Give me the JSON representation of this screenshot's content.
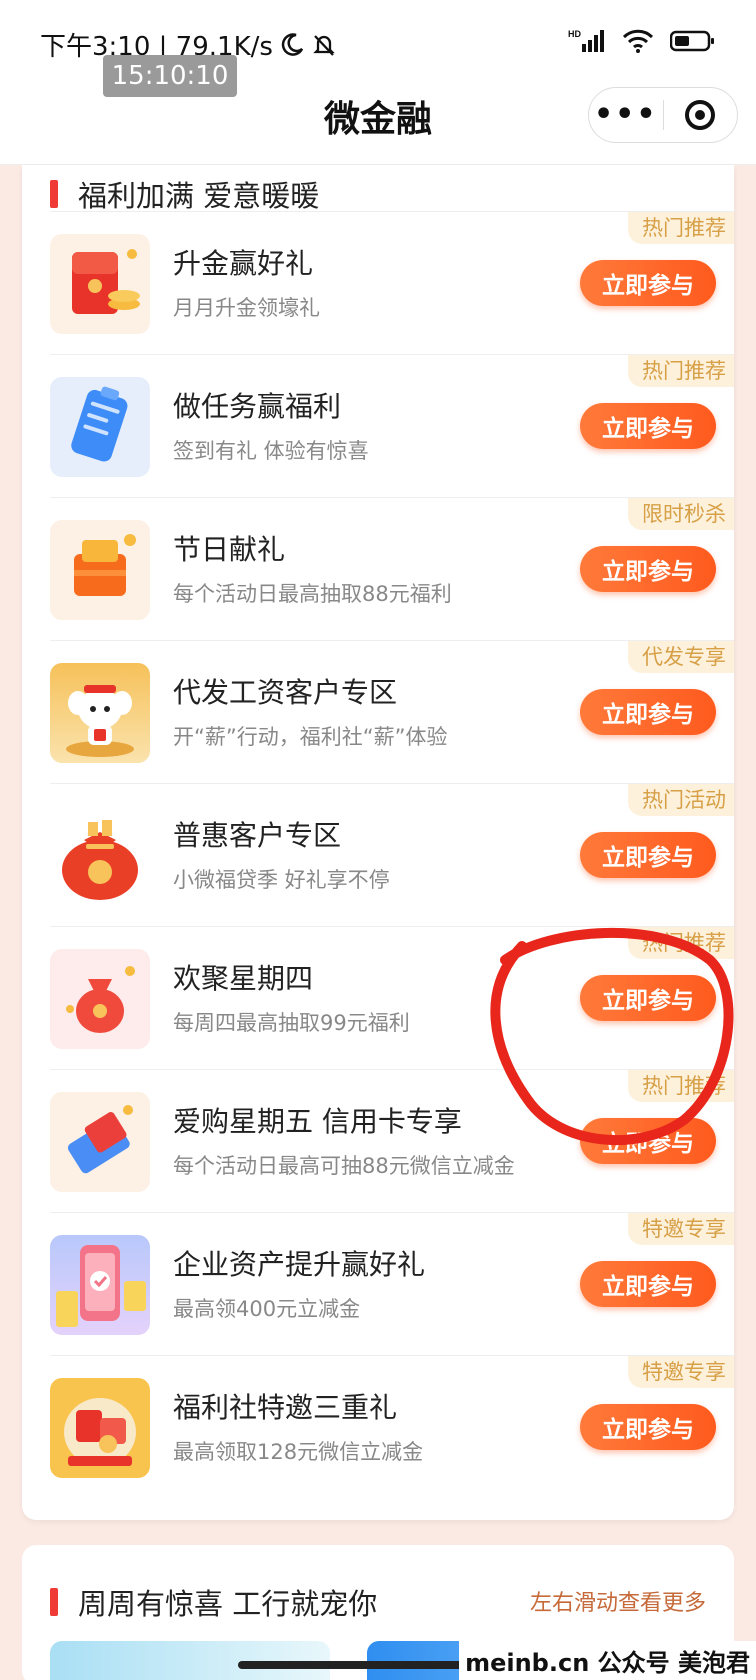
{
  "status_bar": {
    "time_speed": "下午3:10 | 79.1K/s",
    "clock_badge": "15:10:10",
    "network": "HD"
  },
  "nav": {
    "title": "微金融",
    "more": "•••"
  },
  "section1": {
    "title": "福利加满 爱意暖暖",
    "button_label": "立即参与",
    "items": [
      {
        "title": "升金赢好礼",
        "subtitle": "月月升金领壕礼",
        "tag": "热门推荐"
      },
      {
        "title": "做任务赢福利",
        "subtitle": "签到有礼 体验有惊喜",
        "tag": "热门推荐"
      },
      {
        "title": "节日献礼",
        "subtitle": "每个活动日最高抽取88元福利",
        "tag": "限时秒杀"
      },
      {
        "title": "代发工资客户专区",
        "subtitle": "开“薪”行动，福利社“薪”体验",
        "tag": "代发专享"
      },
      {
        "title": "普惠客户专区",
        "subtitle": "小微福贷季 好礼享不停",
        "tag": "热门活动"
      },
      {
        "title": "欢聚星期四",
        "subtitle": "每周四最高抽取99元福利",
        "tag": "热门推荐"
      },
      {
        "title": "爱购星期五 信用卡专享",
        "subtitle": "每个活动日最高可抽88元微信立减金",
        "tag": "热门推荐"
      },
      {
        "title": "企业资产提升赢好礼",
        "subtitle": "最高领400元立减金",
        "tag": "特邀专享"
      },
      {
        "title": "福利社特邀三重礼",
        "subtitle": "最高领取128元微信立减金",
        "tag": "特邀专享"
      }
    ]
  },
  "section2": {
    "title": "周周有惊喜 工行就宠你",
    "more": "左右滑动查看更多"
  },
  "watermark": "meinb.cn 公众号 美泡君",
  "colors": {
    "accent": "#ff5a1e",
    "tag_bg": "#fdf1dc",
    "tag_text": "#d7a047",
    "annotation": "#e8261b"
  }
}
